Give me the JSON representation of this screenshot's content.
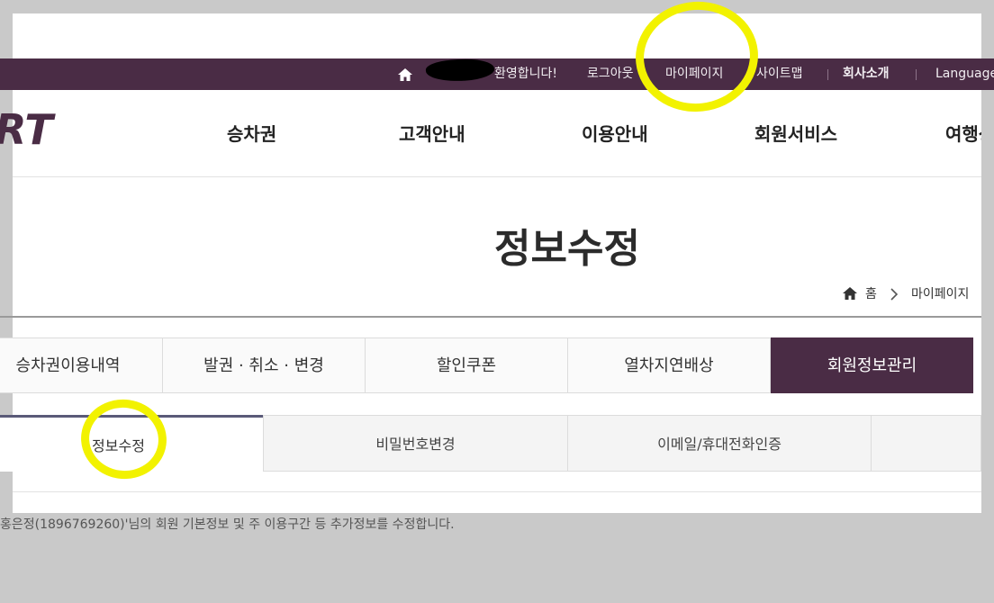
{
  "topbar": {
    "welcome": "환영합니다!",
    "logout": "로그아웃",
    "mypage": "마이페이지",
    "sitemap": "사이트맵",
    "company": "회사소개",
    "language": "Language"
  },
  "header": {
    "logo_text": "RT",
    "nav": [
      "승차권",
      "고객안내",
      "이용안내",
      "회원서비스",
      "여행상"
    ]
  },
  "page": {
    "title": "정보수정",
    "breadcrumb": {
      "home": "홈",
      "mypage": "마이페이지"
    }
  },
  "tabs_primary": [
    "승차권이용내역",
    "발권 · 취소 · 변경",
    "할인쿠폰",
    "열차지연배상",
    "회원정보관리"
  ],
  "tabs_secondary": [
    "정보수정",
    "비밀번호변경",
    "이메일/휴대전화인증"
  ],
  "description": "홍은정(1896769260)'님의 회원 기본정보 및 주 이용구간 등 추가정보를 수정합니다.",
  "colors": {
    "brand": "#4a2c45",
    "highlight": "#f2f200",
    "redaction": "#000000"
  }
}
